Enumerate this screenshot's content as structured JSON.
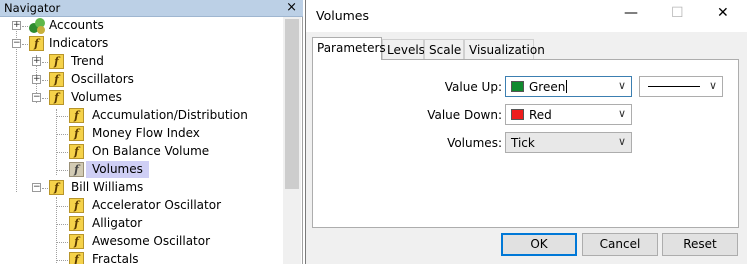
{
  "navigator": {
    "title": "Navigator",
    "close_glyph": "×",
    "tree": {
      "accounts": "Accounts",
      "indicators": "Indicators",
      "trend": "Trend",
      "oscillators": "Oscillators",
      "volumes": "Volumes",
      "volumes_items": [
        "Accumulation/Distribution",
        "Money Flow Index",
        "On Balance Volume",
        "Volumes"
      ],
      "bill_williams": "Bill Williams",
      "bill_williams_items": [
        "Accelerator Oscillator",
        "Alligator",
        "Awesome Oscillator",
        "Fractals"
      ]
    },
    "selected_item": "Volumes"
  },
  "dialog": {
    "title": "Volumes",
    "controls": {
      "minimize": "—",
      "maximize": "☐",
      "close": "✕"
    },
    "tabs": [
      "Parameters",
      "Levels",
      "Scale",
      "Visualization"
    ],
    "active_tab": "Parameters",
    "fields": {
      "value_up": {
        "label": "Value Up:",
        "value": "Green",
        "color": "#108a2e"
      },
      "value_down": {
        "label": "Value Down:",
        "value": "Red",
        "color": "#ee1c1c"
      },
      "volumes": {
        "label": "Volumes:",
        "value": "Tick"
      }
    },
    "line_style": "solid",
    "buttons": {
      "ok": "OK",
      "cancel": "Cancel",
      "reset": "Reset"
    }
  },
  "icons": {
    "function_icon": "f",
    "expander_collapsed": "+",
    "expander_expanded": "−",
    "chevron_down": "∨"
  }
}
